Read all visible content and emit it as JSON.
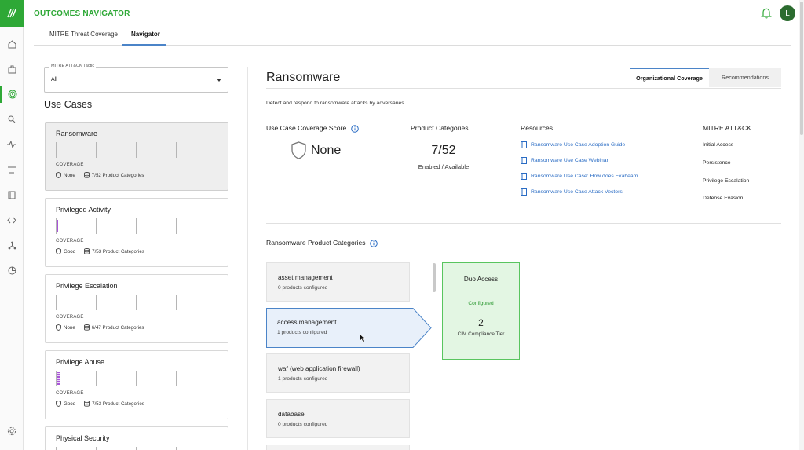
{
  "app": {
    "title": "OUTCOMES NAVIGATOR",
    "avatar_initial": "L"
  },
  "rail": {
    "icons": [
      "home-icon",
      "briefcase-icon",
      "target-icon",
      "search-icon",
      "activity-icon",
      "list-icon",
      "book-icon",
      "code-icon",
      "hierarchy-icon",
      "pie-chart-icon",
      "settings-icon"
    ],
    "active": "target-icon",
    "accent": "#2ea836"
  },
  "tabs": [
    {
      "label": "MITRE Threat Coverage"
    },
    {
      "label": "Navigator",
      "active": true
    }
  ],
  "tactic": {
    "label": "MITRE ATT&CK Tactic",
    "value": "All"
  },
  "use_cases": {
    "title": "Use Cases",
    "coverage_label": "COVERAGE",
    "items": [
      {
        "name": "Ransomware",
        "coverage": "None",
        "categories": "7/52 Product Categories",
        "selected": true,
        "level": 0
      },
      {
        "name": "Privileged Activity",
        "coverage": "Good",
        "categories": "7/53 Product Categories",
        "level": 1
      },
      {
        "name": "Privilege Escalation",
        "coverage": "None",
        "categories": "6/47 Product Categories",
        "level": 0
      },
      {
        "name": "Privilege Abuse",
        "coverage": "Good",
        "categories": "7/53 Product Categories",
        "level": 1
      },
      {
        "name": "Physical Security"
      }
    ]
  },
  "detail": {
    "title": "Ransomware",
    "tabs": {
      "active": "Organizational Coverage",
      "inactive": "Recommendations"
    },
    "description": "Detect and respond to ransomware attacks by adversaries.",
    "score": {
      "label": "Use Case Coverage Score",
      "value": "None"
    },
    "product_categories": {
      "label": "Product Categories",
      "value": "7/52",
      "sub": "Enabled / Available"
    },
    "resources": {
      "label": "Resources",
      "items": [
        "Ransomware Use Case Adoption Guide",
        "Ransomware Use Case Webinar",
        "Ransomware Use Case: How does Exabeam...",
        "Ransomware Use Case Attack Vectors"
      ]
    },
    "mitre": {
      "label": "MITRE ATT&CK",
      "items": [
        "Initial Access",
        "Persistence",
        "Privilege Escalation",
        "Defense Evasion"
      ]
    },
    "categories": {
      "label": "Ransomware Product Categories",
      "items": [
        {
          "name": "asset management",
          "status": "0 products configured"
        },
        {
          "name": "access management",
          "status": "1 products configured",
          "selected": true
        },
        {
          "name": "waf (web application firewall)",
          "status": "1 products configured"
        },
        {
          "name": "database",
          "status": "0 products configured"
        }
      ]
    },
    "product": {
      "name": "Duo Access",
      "status": "Configured",
      "tier": "2",
      "tier_label": "CIM Compliance Tier"
    }
  },
  "colors": {
    "green": "#2ea836",
    "link": "#2a6cc4",
    "tab_accent": "#4b84c8",
    "coverage_bar": "#a955d8"
  }
}
